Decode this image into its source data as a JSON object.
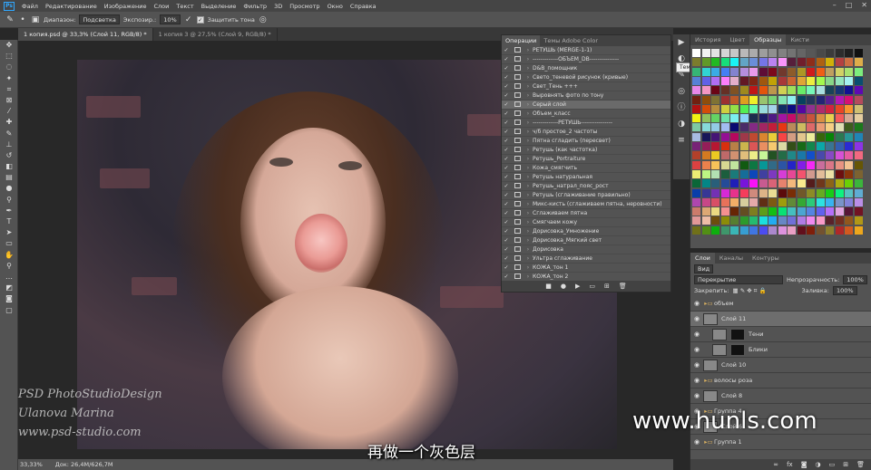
{
  "menubar": {
    "logo": "Ps",
    "items": [
      "Файл",
      "Редактирование",
      "Изображение",
      "Слои",
      "Текст",
      "Выделение",
      "Фильтр",
      "3D",
      "Просмотр",
      "Окно",
      "Справка"
    ]
  },
  "options": {
    "range_label": "Диапазон:",
    "range_value": "Подсветка",
    "exposure_label": "Экспозир.:",
    "exposure_value": "10%",
    "protect_label": "Защитить тона"
  },
  "tabs": [
    {
      "label": "1 копия.psd @ 33,3% (Слой 11, RGB/8) *"
    },
    {
      "label": "1 копия 3 @ 27,5% (Слой 9, RGB/8) *"
    }
  ],
  "status": {
    "zoom": "33,33%",
    "doc": "Док: 26,4M/626,7M"
  },
  "actions_panel": {
    "tabs": [
      "Операции",
      "Темы Adobe Color"
    ],
    "rows": [
      {
        "label": "РЕТУШЬ (MERGE-1-1)",
        "sel": false
      },
      {
        "label": "-------------ОБЪЕМ_DB---------------",
        "sel": false
      },
      {
        "label": "D&B_помощник",
        "sel": false
      },
      {
        "label": "Свето_теневой рисунок (кривые)",
        "sel": false
      },
      {
        "label": "Свет_Тень +++",
        "sel": false
      },
      {
        "label": "Выровнять фото по тону",
        "sel": false
      },
      {
        "label": "Серый слой",
        "sel": true
      },
      {
        "label": "Объем_класс",
        "sel": false
      },
      {
        "label": "-------------РЕТУШЬ----------------",
        "sel": false
      },
      {
        "label": "ч/б простое_2 частоты",
        "sel": false
      },
      {
        "label": "Пятна сгладить (пересвет)",
        "sel": false
      },
      {
        "label": "Ретушь (как частотка)",
        "sel": false
      },
      {
        "label": "Ретушь_Portraiture",
        "sel": false
      },
      {
        "label": "Кожа_смягчить",
        "sel": false
      },
      {
        "label": "Ретушь натуральная",
        "sel": false
      },
      {
        "label": "Ретушь_натрал_пояс_рост",
        "sel": false
      },
      {
        "label": "Ретушь (сглаживание правильно)",
        "sel": false
      },
      {
        "label": "Микс-кисть (сглаживаем пятна, неровности)",
        "sel": false
      },
      {
        "label": "Сглаживаем пятна",
        "sel": false
      },
      {
        "label": "Смягчаем кожу",
        "sel": false
      },
      {
        "label": "Дорисовка_Умножение",
        "sel": false
      },
      {
        "label": "Дорисовка_Мягкий свет",
        "sel": false
      },
      {
        "label": "Дорисовка",
        "sel": false
      },
      {
        "label": "Ультра сглаживание",
        "sel": false
      },
      {
        "label": "КОЖА_тон 1",
        "sel": false
      },
      {
        "label": "КОЖА_тон 2",
        "sel": false
      }
    ]
  },
  "tooltip": "Темы Adobe Color",
  "swatches_panel": {
    "tabs": [
      "История",
      "Цвет",
      "Образцы",
      "Кисти"
    ]
  },
  "layers_panel": {
    "tabs": [
      "Слои",
      "Каналы",
      "Контуры"
    ],
    "filter_label": "Вид",
    "blend_mode": "Перекрытие",
    "opacity_label": "Непрозрачность:",
    "opacity_value": "100%",
    "lock_label": "Закрепить:",
    "fill_label": "Заливка:",
    "fill_value": "100%",
    "layers": [
      {
        "name": "объем",
        "type": "group",
        "sel": false
      },
      {
        "name": "Слой 11",
        "type": "layer",
        "sel": true
      },
      {
        "name": "Тени",
        "type": "adj",
        "sel": false
      },
      {
        "name": "Блики",
        "type": "adj",
        "sel": false
      },
      {
        "name": "Слой 10",
        "type": "layer",
        "sel": false
      },
      {
        "name": "волосы роза",
        "type": "group",
        "sel": false
      },
      {
        "name": "Слой 8",
        "type": "layer",
        "sel": false
      },
      {
        "name": "Группа 4",
        "type": "group",
        "sel": false
      },
      {
        "name": "Слой 6",
        "type": "layer",
        "sel": false
      },
      {
        "name": "Группа 1",
        "type": "group",
        "sel": false
      }
    ]
  },
  "subtitle": "再做一个灰色层",
  "watermark": "www.hunls.com",
  "photo_signature": {
    "line1": "PSD PhotoStudioDesign",
    "line2": "Ulanova Marina",
    "line3": "www.psd-studio.com"
  }
}
